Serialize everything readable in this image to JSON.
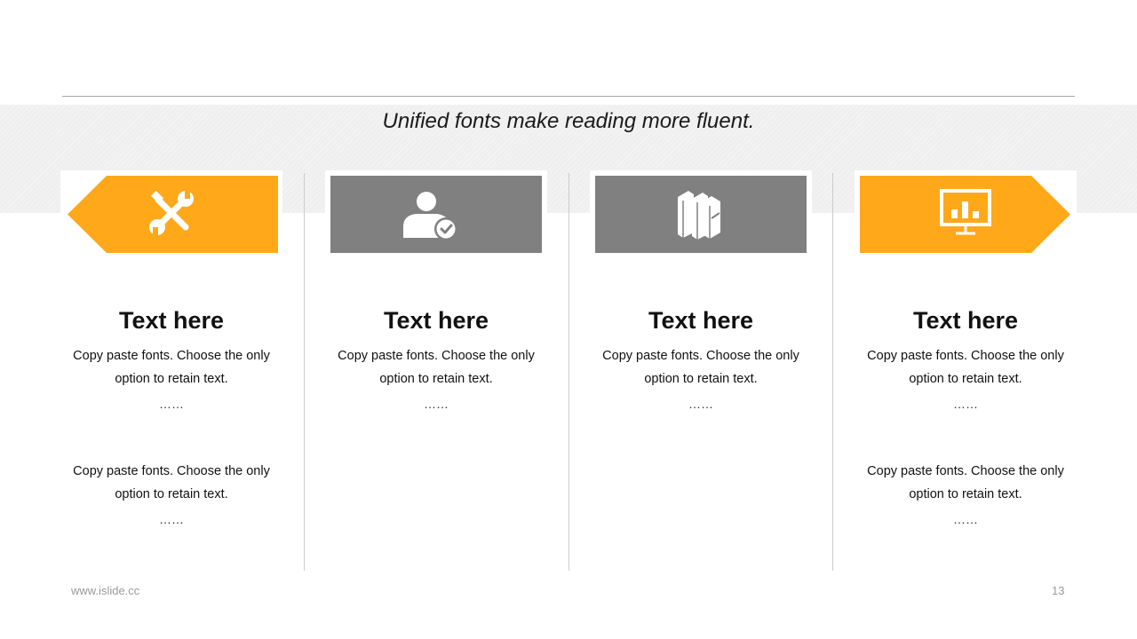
{
  "subtitle": "Unified fonts make reading more fluent.",
  "colors": {
    "accent": "#FFA81A",
    "gray": "#808080",
    "divider": "#CCCCCC"
  },
  "columns": [
    {
      "icon": "tools-icon",
      "title": "Text here",
      "blocks": [
        {
          "text": "Copy paste fonts. Choose the only option to retain text.",
          "ellipsis": "……"
        },
        {
          "text": "Copy paste fonts. Choose the only option to retain text.",
          "ellipsis": "……"
        }
      ]
    },
    {
      "icon": "user-check-icon",
      "title": "Text here",
      "blocks": [
        {
          "text": "Copy paste fonts. Choose the only option to retain text.",
          "ellipsis": "……"
        }
      ]
    },
    {
      "icon": "books-icon",
      "title": "Text here",
      "blocks": [
        {
          "text": "Copy paste fonts. Choose the only option to retain text.",
          "ellipsis": "……"
        }
      ]
    },
    {
      "icon": "presentation-chart-icon",
      "title": "Text here",
      "blocks": [
        {
          "text": "Copy paste fonts. Choose the only option to retain text.",
          "ellipsis": "……"
        },
        {
          "text": "Copy paste fonts. Choose the only option to retain text.",
          "ellipsis": "……"
        }
      ]
    }
  ],
  "footer": {
    "url": "www.islide.cc",
    "page": "13"
  }
}
